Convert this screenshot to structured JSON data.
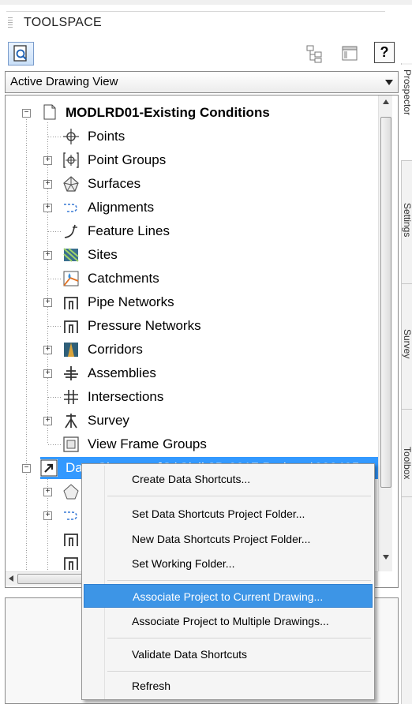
{
  "toolspace": {
    "title": "TOOLSPACE",
    "help_label": "?",
    "view_dropdown": {
      "selected": "Active Drawing View"
    }
  },
  "side_tabs": [
    "Prospector",
    "Settings",
    "Survey",
    "Toolbox"
  ],
  "tree": {
    "root": "MODLRD01-Existing Conditions",
    "items": [
      {
        "label": "Points"
      },
      {
        "label": "Point Groups"
      },
      {
        "label": "Surfaces"
      },
      {
        "label": "Alignments"
      },
      {
        "label": "Feature Lines"
      },
      {
        "label": "Sites"
      },
      {
        "label": "Catchments"
      },
      {
        "label": "Pipe Networks"
      },
      {
        "label": "Pressure Networks"
      },
      {
        "label": "Corridors"
      },
      {
        "label": "Assemblies"
      },
      {
        "label": "Intersections"
      },
      {
        "label": "Survey"
      },
      {
        "label": "View Frame Groups"
      }
    ],
    "data_shortcuts_label": "Data Shortcuts [C:\\Civil 3D 2017 Projects\\220495..."
  },
  "context_menu": {
    "items": [
      {
        "label": "Create Data Shortcuts..."
      },
      {
        "label": "Set Data Shortcuts Project Folder..."
      },
      {
        "label": "New Data Shortcuts Project Folder..."
      },
      {
        "label": "Set Working Folder..."
      },
      {
        "label": "Associate Project to Current Drawing..."
      },
      {
        "label": "Associate Project to Multiple Drawings..."
      },
      {
        "label": "Validate Data Shortcuts"
      },
      {
        "label": "Refresh"
      }
    ],
    "highlighted": "Associate Project to Current Drawing..."
  },
  "colors": {
    "selection": "#3399ff",
    "menu_highlight": "#3d95e6"
  }
}
